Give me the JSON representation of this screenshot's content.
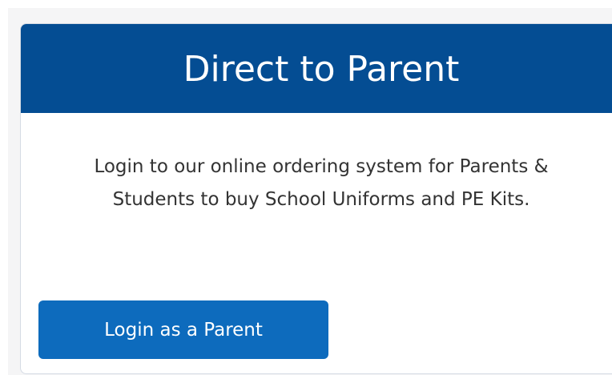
{
  "card": {
    "title": "Direct to Parent",
    "description_line1": "Login to our online ordering system for Parents &",
    "description_line2": "Students to buy School Uniforms and PE Kits.",
    "login_button_label": "Login as a Parent"
  },
  "colors": {
    "header_background": "#044d93",
    "button_background": "#0d6bbd",
    "text": "#333333"
  }
}
